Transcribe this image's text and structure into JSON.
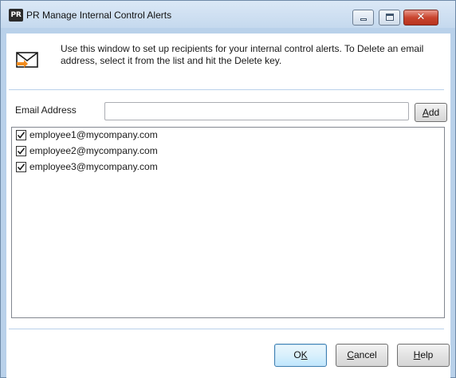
{
  "window": {
    "app_icon_text": "PR",
    "title": "PR Manage Internal Control Alerts",
    "close_glyph": "✕"
  },
  "info": {
    "icon": "envelope-icon",
    "text": "Use this window to set up recipients for your internal control alerts. To Delete an email address, select it from the list and hit the Delete key."
  },
  "email": {
    "label": "Email Address",
    "value": "",
    "placeholder": "",
    "add_prefix": "",
    "add_mnemonic": "A",
    "add_rest": "dd"
  },
  "recipients": [
    {
      "email": "employee1@mycompany.com",
      "checked": true
    },
    {
      "email": "employee2@mycompany.com",
      "checked": true
    },
    {
      "email": "employee3@mycompany.com",
      "checked": true
    }
  ],
  "footer": {
    "ok_prefix": "O",
    "ok_mnemonic": "K",
    "ok_rest": "",
    "cancel_prefix": "",
    "cancel_mnemonic": "C",
    "cancel_rest": "ancel",
    "help_prefix": "",
    "help_mnemonic": "H",
    "help_rest": "elp"
  },
  "colors": {
    "frame": "#b9d1ea",
    "close_button": "#c9452f",
    "default_button_border": "#3c7fb1"
  }
}
